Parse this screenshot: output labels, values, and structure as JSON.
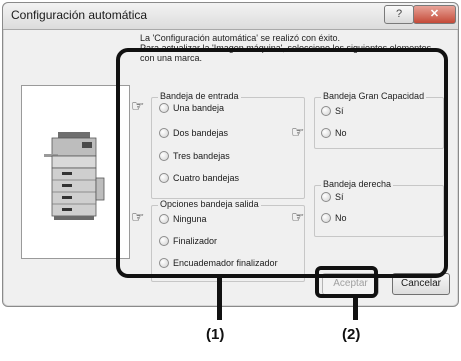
{
  "window": {
    "title": "Configuración automática",
    "help_label": "?",
    "close_label": "✕"
  },
  "info": {
    "line1": "La 'Configuración automática' se realizó con éxito.",
    "line2": "Para actualizar la 'Imagen máquina', seleccione los siguientes elementos",
    "line3": "con una marca."
  },
  "groups": {
    "bandeja_entrada": {
      "title": "Bandeja de entrada",
      "options": [
        "Una bandeja",
        "Dos bandejas",
        "Tres bandejas",
        "Cuatro bandejas"
      ]
    },
    "opciones_salida": {
      "title": "Opciones bandeja salida",
      "options": [
        "Ninguna",
        "Finalizador",
        "Encuademador finalizador"
      ]
    },
    "gran_capacidad": {
      "title": "Bandeja Gran Capacidad",
      "options": [
        "Sí",
        "No"
      ]
    },
    "bandeja_derecha": {
      "title": "Bandeja derecha",
      "options": [
        "Sí",
        "No"
      ]
    }
  },
  "buttons": {
    "accept": "Aceptar",
    "cancel": "Cancelar"
  },
  "callouts": {
    "one": "(1)",
    "two": "(2)"
  },
  "icons": {
    "pointer_hand": "pointing-hand-icon",
    "machine": "printer-machine-icon"
  }
}
